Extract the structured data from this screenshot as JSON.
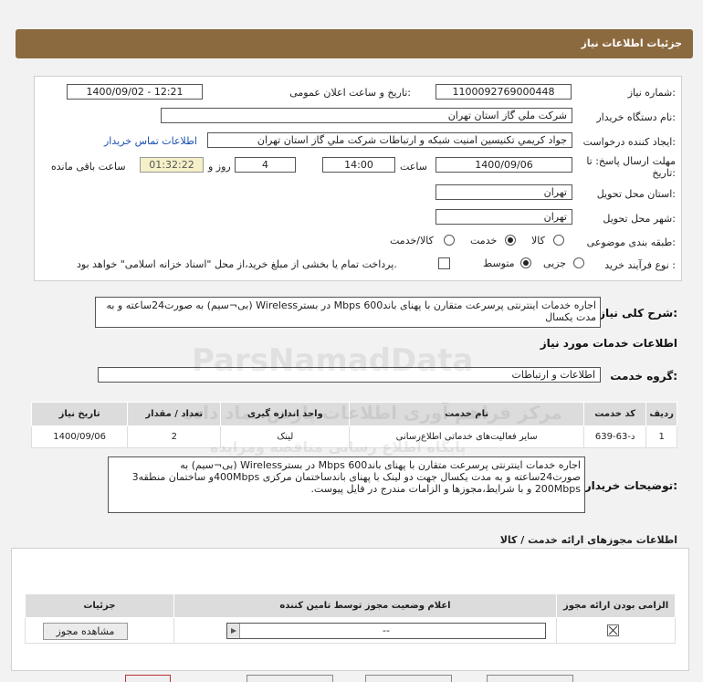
{
  "header": {
    "title": "جزئیات اطلاعات نیاز"
  },
  "form": {
    "need_number_label": "شماره نیاز:",
    "need_number": "1100092769000448",
    "announce_label": "تاریخ و ساعت اعلان عمومی:",
    "announce_value": "1400/09/02 - 12:21",
    "buyer_label": "نام دستگاه خریدار:",
    "buyer": "شرکت ملي گاز استان تهران",
    "creator_label": "ایجاد کننده درخواست:",
    "creator": "جواد کريمي تکنيسين امنيت شبکه و ارتباطات شرکت ملي گاز استان تهران",
    "contact_link": "اطلاعات تماس خریدار",
    "deadline_label_1": "مهلت ارسال پاسخ: تا",
    "deadline_label_2": "تاریخ:",
    "deadline_date": "1400/09/06",
    "time_label": "ساعت",
    "deadline_time": "14:00",
    "days_value": "4",
    "days_label": "روز و",
    "remaining_time": "01:32:22",
    "remaining_label": "ساعت باقی مانده",
    "province_label": "استان محل تحویل:",
    "province": "تهران",
    "city_label": "شهر محل تحویل:",
    "city": "تهران",
    "category_label": "طبقه بندی موضوعی:",
    "category_options": [
      "کالا",
      "خدمت",
      "کالا/خدمت"
    ],
    "category_selected": "خدمت",
    "process_label": "نوع فرآیند خرید :",
    "process_options": [
      "جزیی",
      "متوسط"
    ],
    "process_selected": "متوسط",
    "payment_note": "پرداخت تمام یا بخشی از مبلغ خرید،از محل \"اسناد خزانه اسلامی\" خواهد بود."
  },
  "description": {
    "label": "شرح کلی نیاز:",
    "text": "اجاره خدمات اینترنتی پرسرعت متقارن با پهنای باند600 Mbps در بسترWireless (بی¬سیم) به صورت24ساعته و به مدت یکسال"
  },
  "services": {
    "section_title": "اطلاعات خدمات مورد نیاز",
    "group_label": "گروه خدمت:",
    "group_value": "اطلاعات و ارتباطات",
    "table_headers": [
      "ردیف",
      "کد خدمت",
      "نام خدمت",
      "واحد اندازه گیری",
      "تعداد / مقدار",
      "تاریخ نیاز"
    ],
    "rows": [
      [
        "1",
        "د-63-639",
        "سایر فعالیت‌های خدماتی اطلاع‌رسانی",
        "لینک",
        "2",
        "1400/09/06"
      ]
    ]
  },
  "buyer_notes": {
    "label": "توضیحات خریدار:",
    "text": "اجاره خدمات اینترنتی پرسرعت متقارن با پهنای باند600 Mbps در بسترWireless (بی¬سیم) به صورت24ساعته و به مدت یکسال جهت دو لینک با پهنای باندساختمان مرکزی 400Mbpsو ساختمان منطقه3 200Mbps و با شرایط،مجوزها و الزامات مندرج در فایل پیوست."
  },
  "permits": {
    "section_title": "اطلاعات مجوزهای ارائه خدمت / کالا",
    "headers": [
      "الزامی بودن ارائه مجوز",
      "اعلام وضعیت مجوز توسط تامین کننده",
      "جزئیات"
    ],
    "status_value": "--",
    "view_button": "مشاهده مجوز"
  },
  "watermark": {
    "line1": "ParsNamadData",
    "line2": "مرکز فراهم آوری اطلاعات پارس نماد داده",
    "line3": "پایگاه اطلاع رسانی مناقصه ومزایده"
  }
}
